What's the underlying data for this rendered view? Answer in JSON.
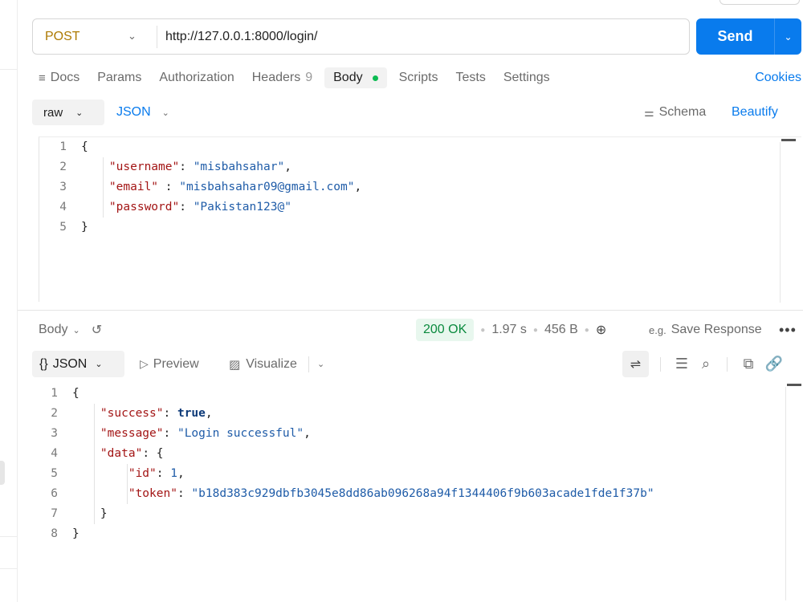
{
  "request": {
    "method": "POST",
    "url": "http://127.0.0.1:8000/login/",
    "send_label": "Send",
    "tabs": [
      {
        "label": "Docs"
      },
      {
        "label": "Params"
      },
      {
        "label": "Authorization"
      },
      {
        "label": "Headers",
        "count": "9"
      },
      {
        "label": "Body"
      },
      {
        "label": "Scripts"
      },
      {
        "label": "Tests"
      },
      {
        "label": "Settings"
      }
    ],
    "cookies_label": "Cookies",
    "body_mode": "raw",
    "body_format": "JSON",
    "schema_label": "Schema",
    "beautify_label": "Beautify",
    "line_numbers": [
      "1",
      "2",
      "3",
      "4",
      "5"
    ],
    "body_lines": {
      "open": "{",
      "username_key": "\"username\"",
      "username_val": "\"misbahsahar\"",
      "email_key": "\"email\"",
      "email_val": "\"misbahsahar09@gmail.com\"",
      "password_key": "\"password\"",
      "password_val": "\"Pakistan123@\"",
      "close": "}"
    }
  },
  "response": {
    "body_label": "Body",
    "status": "200 OK",
    "time": "1.97 s",
    "size": "456 B",
    "save_label": "Save Response",
    "format": "JSON",
    "preview_label": "Preview",
    "visualize_label": "Visualize",
    "line_numbers": [
      "1",
      "2",
      "3",
      "4",
      "5",
      "6",
      "7",
      "8"
    ],
    "lines": {
      "open": "{",
      "success_key": "\"success\"",
      "success_val": "true",
      "message_key": "\"message\"",
      "message_val": "\"Login successful\"",
      "data_key": "\"data\"",
      "data_open": "{",
      "id_key": "\"id\"",
      "id_val": "1",
      "token_key": "\"token\"",
      "token_val": "\"b18d383c929dbfb3045e8dd86ab096268a94f1344406f9b603acade1fde1f37b\"",
      "data_close": "}",
      "close": "}"
    }
  },
  "colors": {
    "accent": "#097bed",
    "method": "#ad7a03",
    "status_ok": "#0a8a3e",
    "body_dot": "#0cbb52"
  }
}
